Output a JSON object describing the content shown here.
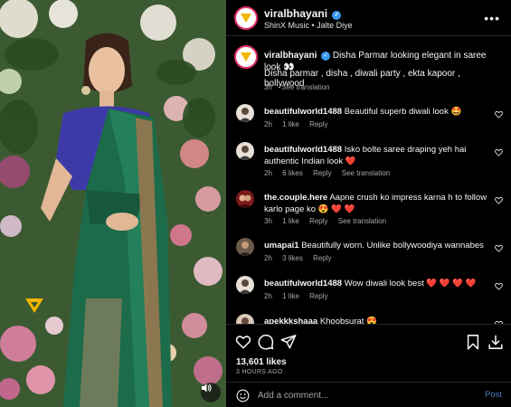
{
  "post": {
    "username": "viralbhayani",
    "subtitle": "ShinX Music • Jalte Diye"
  },
  "caption": {
    "username": "viralbhayani",
    "text": "Disha Parmar looking elegant in saree look 👀",
    "tags": "Disha parmar , disha , diwali party , ekta kapoor , bollywood",
    "time": "3h",
    "see_translation": "See translation"
  },
  "comments": [
    {
      "username": "beautifulworld1488",
      "text": "Beautiful superb diwali look 🤩",
      "time": "2h",
      "likes": "1 like",
      "reply": "Reply",
      "see_translation": ""
    },
    {
      "username": "beautifulworld1488",
      "text": "Isko bolte saree draping yeh hai authentic Indian look ❤️",
      "time": "2h",
      "likes": "6 likes",
      "reply": "Reply",
      "see_translation": "See translation"
    },
    {
      "username": "the.couple.here",
      "text": "Aapne crush ko impress karna h to follow karlo page ko 😍 ❤️ ❤️",
      "time": "3h",
      "likes": "1 like",
      "reply": "Reply",
      "see_translation": "See translation"
    },
    {
      "username": "umapai1",
      "text": "Beautifully worn. Unlike bollywoodiya wannabes",
      "time": "2h",
      "likes": "3 likes",
      "reply": "Reply",
      "see_translation": ""
    },
    {
      "username": "beautifulworld1488",
      "text": "Wow diwali look best ❤️ ❤️ ❤️ ❤️",
      "time": "2h",
      "likes": "1 like",
      "reply": "Reply",
      "see_translation": ""
    },
    {
      "username": "apekkkshaaa",
      "text": "Khoobsurat 😍",
      "time": "",
      "likes": "",
      "reply": "",
      "see_translation": ""
    }
  ],
  "stats": {
    "likes": "13,601 likes",
    "time": "3 HOURS AGO"
  },
  "composer": {
    "placeholder": "Add a comment...",
    "post_label": "Post"
  },
  "colors": {
    "background": "#000000",
    "text": "#f5f5f5",
    "muted": "#a8a8a8",
    "verified": "#3897f0",
    "heart": "#ff3040",
    "post_link": "#4a7fbf"
  },
  "icons": {
    "like": "heart-icon",
    "comment": "comment-icon",
    "share": "send-icon",
    "save": "bookmark-icon",
    "download": "download-icon",
    "emoji": "smiley-icon",
    "more": "more-icon",
    "audio": "speaker-icon"
  }
}
